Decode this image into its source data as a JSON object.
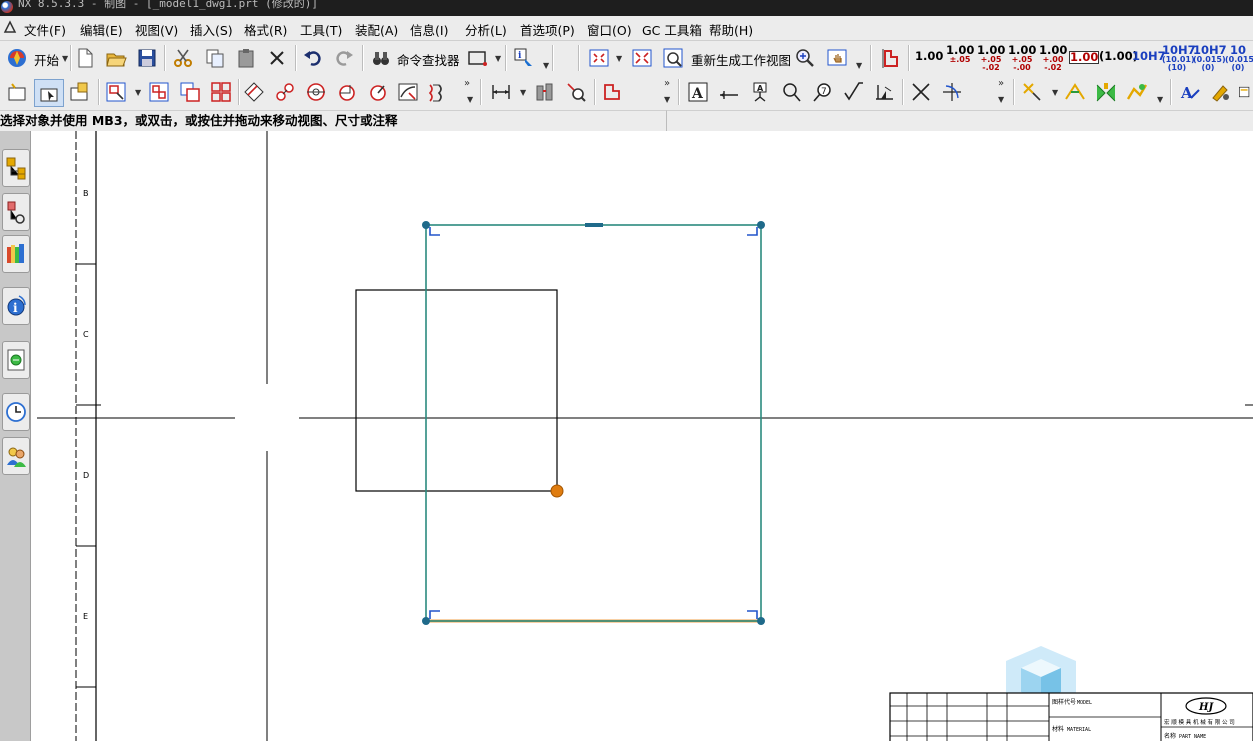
{
  "window": {
    "title": "NX 8.5.3.3 - 制图 - [_model1_dwg1.prt (修改的)]"
  },
  "menu": [
    "文件(F)",
    "编辑(E)",
    "视图(V)",
    "插入(S)",
    "格式(R)",
    "工具(T)",
    "装配(A)",
    "信息(I)",
    "分析(L)",
    "首选项(P)",
    "窗口(O)",
    "GC 工具箱",
    "帮助(H)"
  ],
  "toolbar": {
    "start_label": "开始",
    "command_finder_label": "命令查找器",
    "update_views_label": "重新生成工作视图",
    "tolerance_styles": [
      {
        "main": "1.00",
        "sub": ""
      },
      {
        "main": "1.00",
        "sub": "±.05"
      },
      {
        "main": "1.00",
        "sub": "+.05 -.02"
      },
      {
        "main": "1.00",
        "sub": "+.05 -.00"
      },
      {
        "main": "1.00",
        "sub": "+.00 -.02"
      },
      {
        "main": "1.00",
        "sub": ""
      },
      {
        "main": "(1.00)",
        "sub": ""
      },
      {
        "main": "10H7",
        "sub": ""
      },
      {
        "main": "10H7",
        "sub": "(10.01) (10)"
      },
      {
        "main": "10H7",
        "sub": "(0.015) (0)"
      },
      {
        "main": "10",
        "sub": "(0.015) (0)"
      }
    ]
  },
  "cue_line": "选择对象并使用 MB3，或双击，或按住并拖动来移动视图、尺寸或注释",
  "drawing": {
    "zone_labels": [
      "B",
      "C",
      "D",
      "E"
    ],
    "title_block": {
      "drawing_no_label": "图样代号",
      "drawing_no_value": "MODEL",
      "material_label": "材料",
      "material_value": "MATERIAL",
      "company": "宏 顺 模 具 机 械 有 限 公 司",
      "part_name_label": "名称",
      "part_name_value": "PART NAME",
      "logo_text": "HJ"
    }
  },
  "colors": {
    "selection_border": "#2b8a7e",
    "selection_edge_highlight": "#f0a24a",
    "handle": "#1f6a8a",
    "origin_dot": "#e07d10",
    "corner_marker": "#2255cc"
  }
}
